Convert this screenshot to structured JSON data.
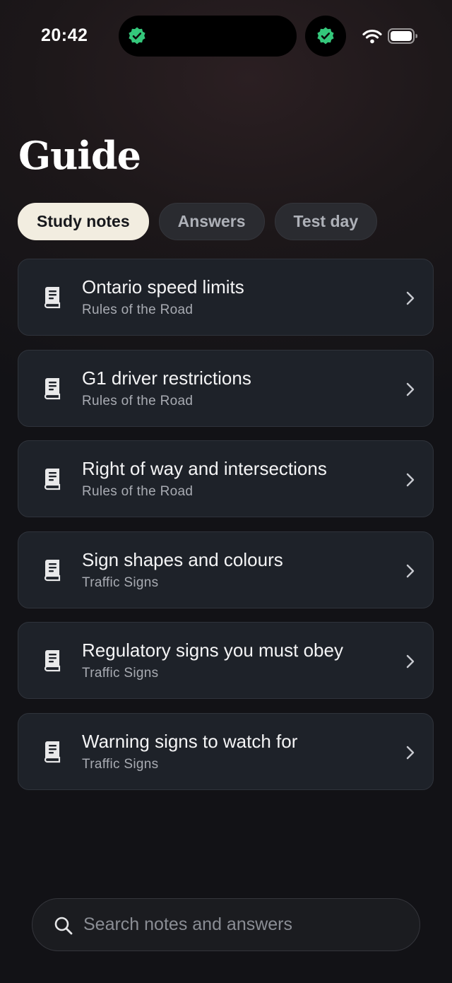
{
  "status_bar": {
    "time": "20:42"
  },
  "page": {
    "title": "Guide"
  },
  "tabs": [
    {
      "label": "Study notes",
      "active": true
    },
    {
      "label": "Answers",
      "active": false
    },
    {
      "label": "Test day",
      "active": false
    }
  ],
  "notes": [
    {
      "title": "Ontario speed limits",
      "category": "Rules of the Road",
      "icon": "book-icon"
    },
    {
      "title": "G1 driver restrictions",
      "category": "Rules of the Road",
      "icon": "book-icon"
    },
    {
      "title": "Right of way and intersections",
      "category": "Rules of the Road",
      "icon": "book-icon"
    },
    {
      "title": "Sign shapes and colours",
      "category": "Traffic Signs",
      "icon": "book-icon"
    },
    {
      "title": "Regulatory signs you must obey",
      "category": "Traffic Signs",
      "icon": "book-icon"
    },
    {
      "title": "Warning signs to watch for",
      "category": "Traffic Signs",
      "icon": "book-icon"
    }
  ],
  "search": {
    "placeholder": "Search notes and answers",
    "value": ""
  },
  "colors": {
    "background": "#151418",
    "card": "#1e2229",
    "active_tab": "#f2ede0",
    "verified_badge": "#34c77b"
  }
}
